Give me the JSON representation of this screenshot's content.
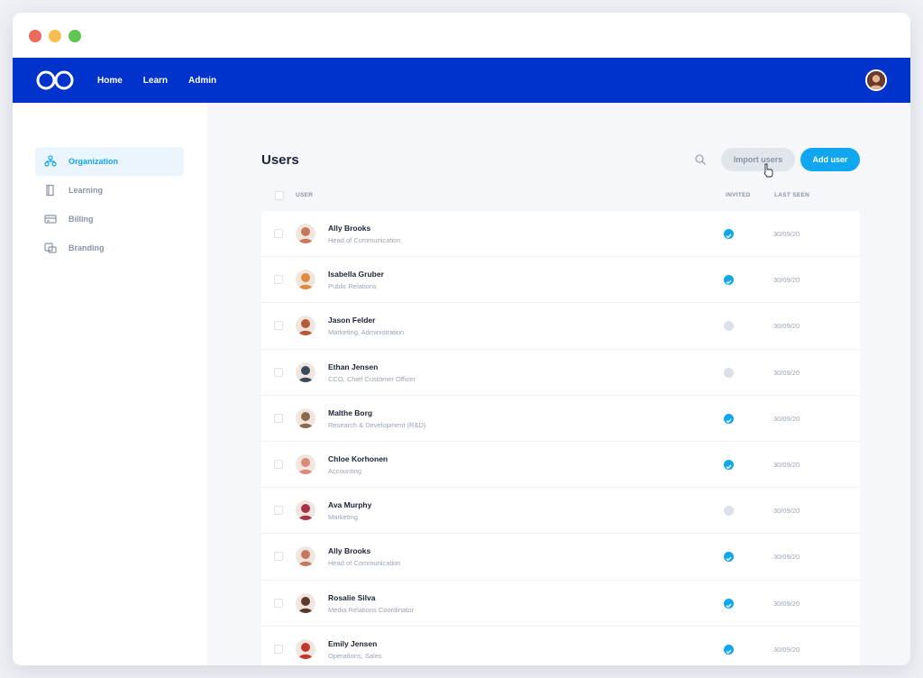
{
  "nav": {
    "links": [
      "Home",
      "Learn",
      "Admin"
    ]
  },
  "sidebar": {
    "items": [
      {
        "label": "Organization",
        "icon": "organization-icon",
        "active": true
      },
      {
        "label": "Learning",
        "icon": "book-icon",
        "active": false
      },
      {
        "label": "Billing",
        "icon": "credit-card-icon",
        "active": false
      },
      {
        "label": "Branding",
        "icon": "brand-icon",
        "active": false
      }
    ]
  },
  "main": {
    "title": "Users",
    "import_label": "Import users",
    "add_label": "Add user",
    "columns": {
      "user": "USER",
      "invited": "INVITED",
      "last_seen": "LAST SEEN"
    }
  },
  "colors": {
    "brand": "#0033cc",
    "accent": "#11a6f0",
    "invited": "#11a6f0",
    "pending": "#dde2ea"
  },
  "users": [
    {
      "name": "Ally Brooks",
      "role": "Head of Communication",
      "invited": true,
      "last_seen": "30/09/20",
      "avatar": "#c47a5a"
    },
    {
      "name": "Isabella Gruber",
      "role": "Public Relations",
      "invited": true,
      "last_seen": "30/09/20",
      "avatar": "#e08a3e"
    },
    {
      "name": "Jason Felder",
      "role": "Marketing, Administration",
      "invited": false,
      "last_seen": "30/09/20",
      "avatar": "#b45a3a"
    },
    {
      "name": "Ethan Jensen",
      "role": "CCO, Chief Customer Officer",
      "invited": false,
      "last_seen": "30/09/20",
      "avatar": "#3a4a5a"
    },
    {
      "name": "Malthe Borg",
      "role": "Research & Development (R&D)",
      "invited": true,
      "last_seen": "30/09/20",
      "avatar": "#8a6a4a"
    },
    {
      "name": "Chloe Korhonen",
      "role": "Accounting",
      "invited": true,
      "last_seen": "30/09/20",
      "avatar": "#d98a7a"
    },
    {
      "name": "Ava Murphy",
      "role": "Marketing",
      "invited": false,
      "last_seen": "30/09/20",
      "avatar": "#a8324a"
    },
    {
      "name": "Ally Brooks",
      "role": "Head of Communication",
      "invited": true,
      "last_seen": "30/09/20",
      "avatar": "#c47a5a"
    },
    {
      "name": "Rosalie Silva",
      "role": "Media Relations Coordinator",
      "invited": true,
      "last_seen": "30/09/20",
      "avatar": "#5a3a2a"
    },
    {
      "name": "Emily Jensen",
      "role": "Operations, Sales",
      "invited": true,
      "last_seen": "30/09/20",
      "avatar": "#c0392b"
    }
  ]
}
